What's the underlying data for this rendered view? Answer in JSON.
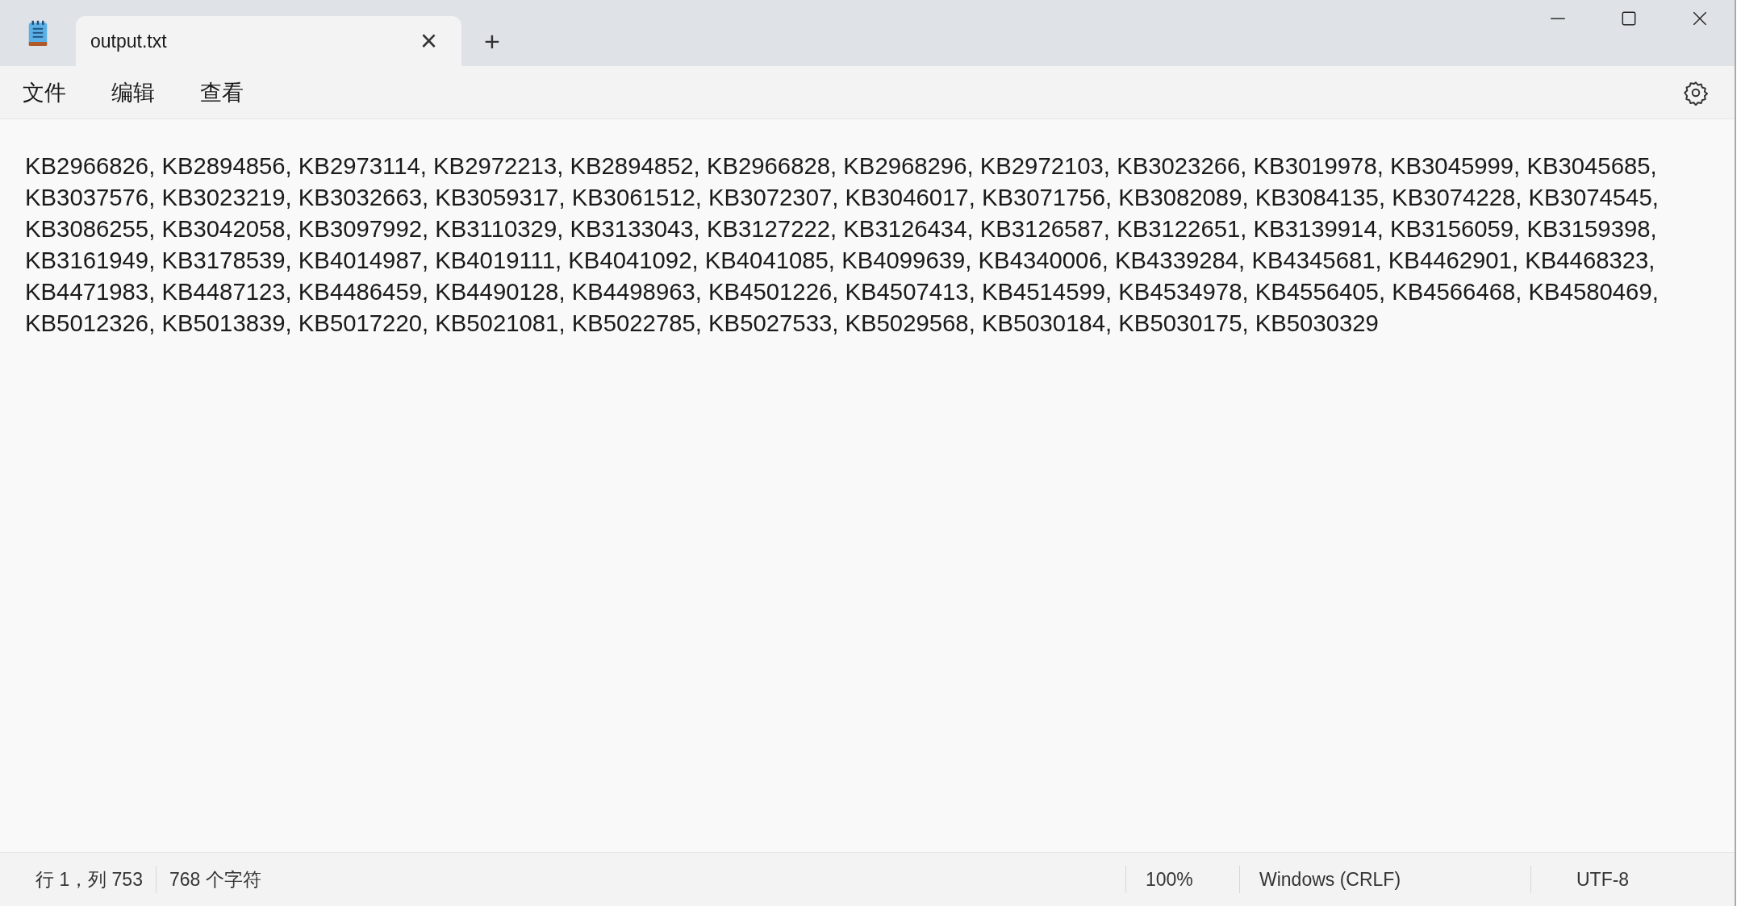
{
  "tabs": [
    {
      "label": "output.txt",
      "selected": true,
      "close": "×"
    }
  ],
  "new_tab": "+",
  "menu": [
    {
      "label": "文件"
    },
    {
      "label": "编辑"
    },
    {
      "label": "查看"
    }
  ],
  "editor": {
    "lines": [
      "KB2966826, KB2894856, KB2973114, KB2972213, KB2894852, KB2966828, KB2968296, KB2972103, KB3023266, KB3019978, KB3045999, KB3045685,",
      "KB3037576, KB3023219, KB3032663, KB3059317, KB3061512, KB3072307, KB3046017, KB3071756, KB3082089, KB3084135, KB3074228, KB3074545,",
      "KB3086255, KB3042058, KB3097992, KB3110329, KB3133043, KB3127222, KB3126434, KB3126587, KB3122651, KB3139914, KB3156059, KB3159398,",
      "KB3161949, KB3178539, KB4014987, KB4019111, KB4041092, KB4041085, KB4099639, KB4340006, KB4339284, KB4345681, KB4462901, KB4468323,",
      "KB4471983, KB4487123, KB4486459, KB4490128, KB4498963, KB4501226, KB4507413, KB4514599, KB4534978, KB4556405, KB4566468, KB4580469,",
      "KB5012326, KB5013839, KB5017220, KB5021081, KB5022785, KB5027533, KB5029568, KB5030184, KB5030175, KB5030329"
    ]
  },
  "status_bar": {
    "position": "行 1，列 753",
    "characters": "768 个字符",
    "zoom": "100%",
    "line_ending": "Windows (CRLF)",
    "encoding": "UTF-8"
  }
}
